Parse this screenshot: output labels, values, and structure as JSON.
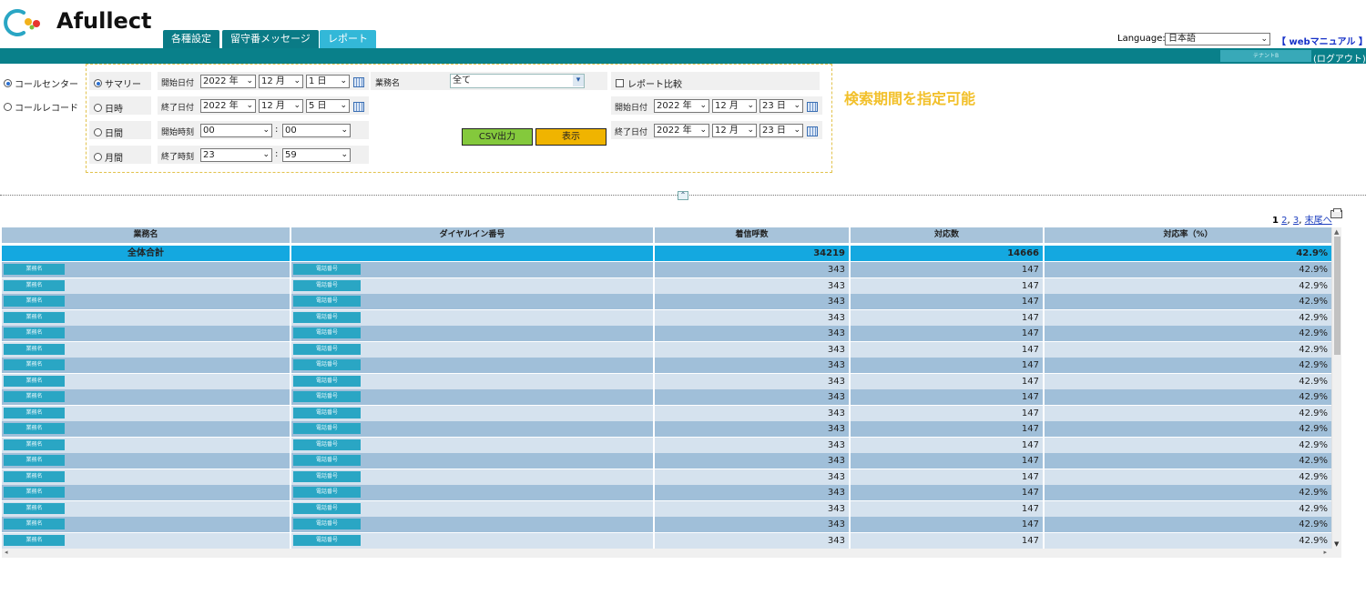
{
  "brand": {
    "logo_text": "Afullect",
    "primary_color": "#09808a",
    "accent_color": "#33b8d8"
  },
  "tabs": [
    {
      "label": "各種設定",
      "active": false
    },
    {
      "label": "留守番メッセージ",
      "active": false
    },
    {
      "label": "レポート",
      "active": true
    }
  ],
  "header": {
    "language_label": "Language:",
    "language_value": "日本語",
    "manual_link": "【 webマニュアル 】",
    "tenant_name": "テナントB",
    "logout_link": "(ログアウト)"
  },
  "left_modes": [
    {
      "label": "コールセンター",
      "selected": true
    },
    {
      "label": "コールレコード",
      "selected": false
    }
  ],
  "periods": [
    {
      "label": "サマリー",
      "selected": true
    },
    {
      "label": "日時",
      "selected": false
    },
    {
      "label": "日間",
      "selected": false
    },
    {
      "label": "月間",
      "selected": false
    }
  ],
  "search": {
    "start_date_label": "開始日付",
    "start_year": "2022 年",
    "start_month": "12 月",
    "start_day": "1 日",
    "end_date_label": "終了日付",
    "end_year": "2022 年",
    "end_month": "12 月",
    "end_day": "5 日",
    "start_time_label": "開始時刻",
    "start_hour": "00",
    "start_minute": "00",
    "end_time_label": "終了時刻",
    "end_hour": "23",
    "end_minute": "59",
    "colon": ":",
    "business_label": "業務名",
    "business_value": "全て",
    "compare_label": "レポート比較",
    "compare_checked": false,
    "cmp_start_label": "開始日付",
    "cmp_start_year": "2022 年",
    "cmp_start_month": "12 月",
    "cmp_start_day": "23 日",
    "cmp_end_label": "終了日付",
    "cmp_end_year": "2022 年",
    "cmp_end_month": "12 月",
    "cmp_end_day": "23 日",
    "csv_button": "CSV出力",
    "show_button": "表示"
  },
  "annotation": "検索期間を指定可能",
  "pagination": {
    "current": "1",
    "pages": [
      "2",
      "3"
    ],
    "last": "末尾へ",
    "sep": ","
  },
  "table": {
    "headers": [
      "業務名",
      "ダイヤルイン番号",
      "着信呼数",
      "対応数",
      "対応率（%）"
    ],
    "total": {
      "name": "全体合計",
      "dialin": "",
      "calls": "34219",
      "handled": "14666",
      "rate": "42.9%"
    },
    "rows": [
      {
        "name": "業務名",
        "dialin": "電話番号",
        "calls": "343",
        "handled": "147",
        "rate": "42.9%"
      },
      {
        "name": "業務名",
        "dialin": "電話番号",
        "calls": "343",
        "handled": "147",
        "rate": "42.9%"
      },
      {
        "name": "業務名",
        "dialin": "電話番号",
        "calls": "343",
        "handled": "147",
        "rate": "42.9%"
      },
      {
        "name": "業務名",
        "dialin": "電話番号",
        "calls": "343",
        "handled": "147",
        "rate": "42.9%"
      },
      {
        "name": "業務名",
        "dialin": "電話番号",
        "calls": "343",
        "handled": "147",
        "rate": "42.9%"
      },
      {
        "name": "業務名",
        "dialin": "電話番号",
        "calls": "343",
        "handled": "147",
        "rate": "42.9%"
      },
      {
        "name": "業務名",
        "dialin": "電話番号",
        "calls": "343",
        "handled": "147",
        "rate": "42.9%"
      },
      {
        "name": "業務名",
        "dialin": "電話番号",
        "calls": "343",
        "handled": "147",
        "rate": "42.9%"
      },
      {
        "name": "業務名",
        "dialin": "電話番号",
        "calls": "343",
        "handled": "147",
        "rate": "42.9%"
      },
      {
        "name": "業務名",
        "dialin": "電話番号",
        "calls": "343",
        "handled": "147",
        "rate": "42.9%"
      },
      {
        "name": "業務名",
        "dialin": "電話番号",
        "calls": "343",
        "handled": "147",
        "rate": "42.9%"
      },
      {
        "name": "業務名",
        "dialin": "電話番号",
        "calls": "343",
        "handled": "147",
        "rate": "42.9%"
      },
      {
        "name": "業務名",
        "dialin": "電話番号",
        "calls": "343",
        "handled": "147",
        "rate": "42.9%"
      },
      {
        "name": "業務名",
        "dialin": "電話番号",
        "calls": "343",
        "handled": "147",
        "rate": "42.9%"
      },
      {
        "name": "業務名",
        "dialin": "電話番号",
        "calls": "343",
        "handled": "147",
        "rate": "42.9%"
      },
      {
        "name": "業務名",
        "dialin": "電話番号",
        "calls": "343",
        "handled": "147",
        "rate": "42.9%"
      },
      {
        "name": "業務名",
        "dialin": "電話番号",
        "calls": "343",
        "handled": "147",
        "rate": "42.9%"
      },
      {
        "name": "業務名",
        "dialin": "電話番号",
        "calls": "343",
        "handled": "147",
        "rate": "42.9%"
      }
    ]
  }
}
